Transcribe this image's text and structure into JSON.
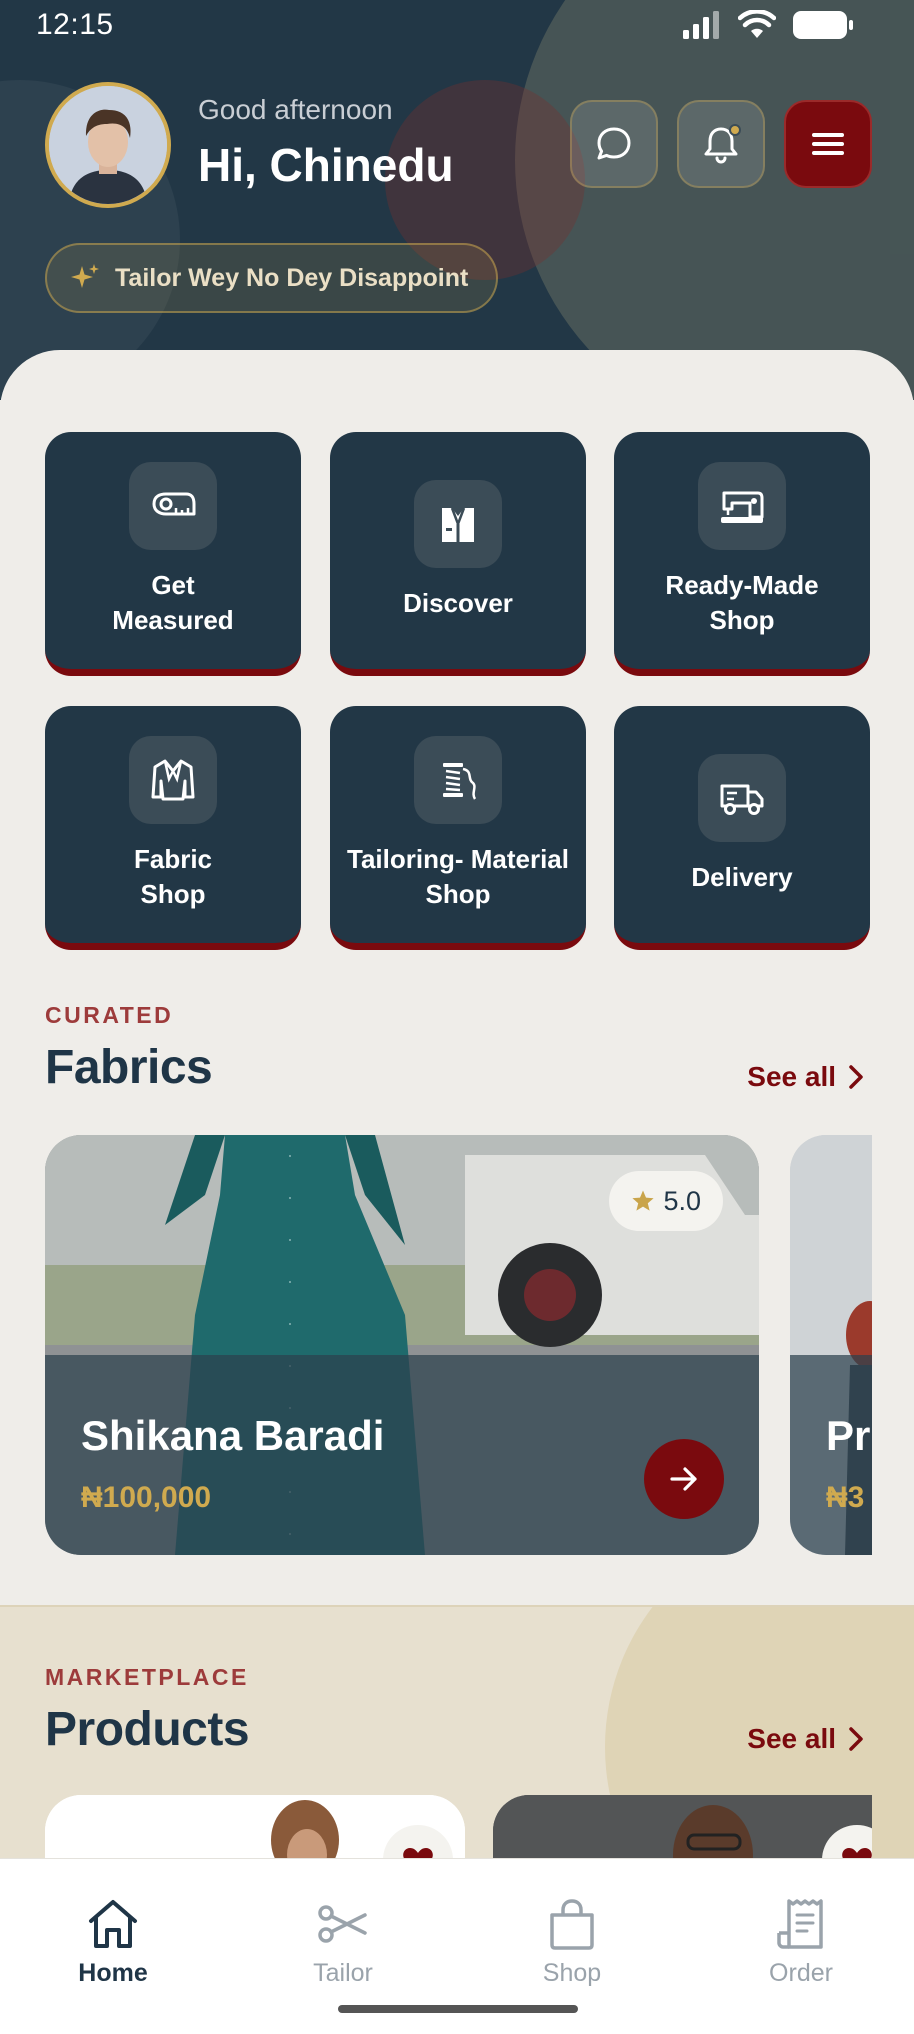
{
  "status_bar": {
    "time": "12:15"
  },
  "header": {
    "greeting": "Good afternoon",
    "user_name": "Hi, Chinedu",
    "tagline": "Tailor Wey No Dey Disappoint",
    "colors": {
      "background": "#223746",
      "accent_gold": "#d0aa4f",
      "brand_red": "#7a0a0e"
    }
  },
  "services": [
    {
      "label": "Get\nMeasured",
      "icon": "measuring-tape-icon"
    },
    {
      "label": "Discover",
      "icon": "suit-icon"
    },
    {
      "label": "Ready-Made\nShop",
      "icon": "sewing-machine-icon"
    },
    {
      "label": "Fabric\nShop",
      "icon": "jacket-icon"
    },
    {
      "label": "Tailoring- Material\nShop",
      "icon": "thread-spool-icon"
    },
    {
      "label": "Delivery",
      "icon": "delivery-truck-icon"
    }
  ],
  "fabrics": {
    "eyebrow": "CURATED",
    "title": "Fabrics",
    "see_all": "See all",
    "items": [
      {
        "name": "Shikana Baradi",
        "price": "₦100,000",
        "rating": "5.0"
      },
      {
        "name": "Pr",
        "price": "₦3"
      }
    ]
  },
  "products": {
    "eyebrow": "MARKETPLACE",
    "title": "Products",
    "see_all": "See all"
  },
  "bottom_nav": [
    {
      "label": "Home",
      "icon": "home-icon",
      "active": true
    },
    {
      "label": "Tailor",
      "icon": "scissors-icon",
      "active": false
    },
    {
      "label": "Shop",
      "icon": "shopping-bag-icon",
      "active": false
    },
    {
      "label": "Order",
      "icon": "receipt-icon",
      "active": false
    }
  ]
}
